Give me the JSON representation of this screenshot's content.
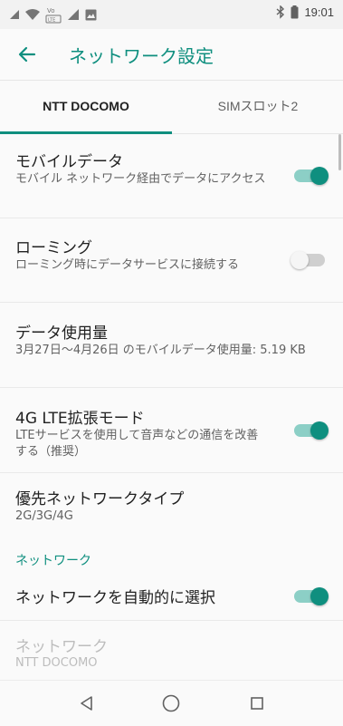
{
  "status_bar": {
    "time": "19:01",
    "icons": [
      "signal-icon",
      "wifi-icon",
      "volte-icon",
      "signal-bars-icon",
      "image-notification-icon",
      "bluetooth-icon",
      "battery-icon"
    ]
  },
  "header": {
    "title": "ネットワーク設定"
  },
  "tabs": [
    {
      "label": "NTT DOCOMO"
    },
    {
      "label": "SIMスロット2"
    }
  ],
  "settings": {
    "mobile_data": {
      "title": "モバイルデータ",
      "summary": "モバイル ネットワーク経由でデータにアクセス"
    },
    "roaming": {
      "title": "ローミング",
      "summary": "ローミング時にデータサービスに接続する"
    },
    "data_usage": {
      "title": "データ使用量",
      "summary": "3月27日〜4月26日 のモバイルデータ使用量: 5.19 KB"
    },
    "lte": {
      "title": "4G LTE拡張モード",
      "summary": "LTEサービスを使用して音声などの通信を改善する（推奨）"
    },
    "preferred_network": {
      "title": "優先ネットワークタイプ",
      "summary": "2G/3G/4G"
    },
    "network_section": "ネットワーク",
    "auto_select": {
      "title": "ネットワークを自動的に選択"
    },
    "network": {
      "title": "ネットワーク",
      "summary": "NTT DOCOMO"
    }
  },
  "colors": {
    "accent": "#0f8f7f",
    "switch_track_on": "#8ccfc6"
  }
}
